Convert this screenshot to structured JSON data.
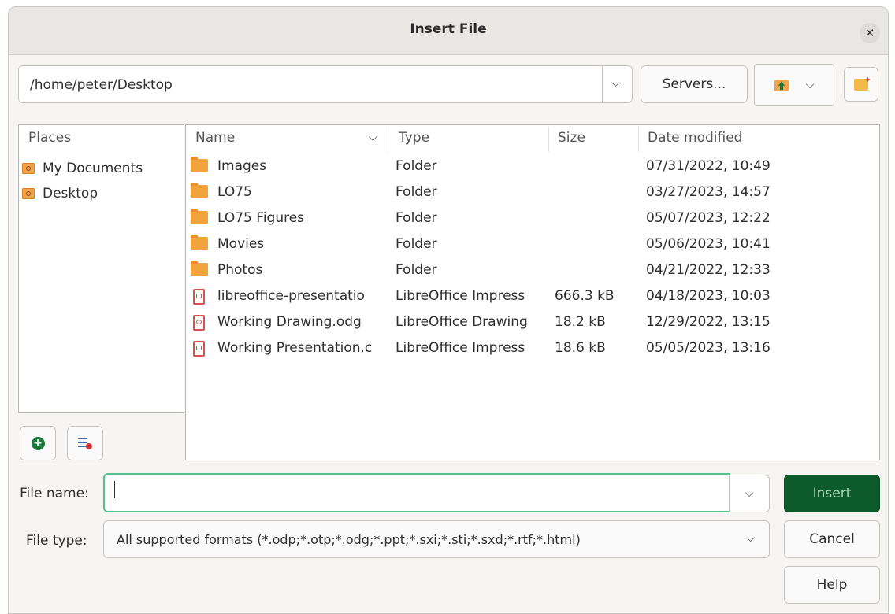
{
  "window": {
    "title": "Insert File",
    "close_icon": "close-icon"
  },
  "toolbar": {
    "path": "/home/peter/Desktop",
    "servers_label": "Servers...",
    "up_icon": "folder-up-icon",
    "new_folder_icon": "new-folder-icon"
  },
  "places": {
    "header": "Places",
    "items": [
      {
        "label": "My Documents",
        "icon": "folder-icon"
      },
      {
        "label": "Desktop",
        "icon": "folder-icon"
      }
    ],
    "add_icon": "add-place-icon",
    "remove_icon": "remove-place-icon"
  },
  "files": {
    "columns": {
      "name": "Name",
      "type": "Type",
      "size": "Size",
      "date": "Date modified"
    },
    "sort_icon": "chevron-down-icon",
    "rows": [
      {
        "name": "Images",
        "type": "Folder",
        "size": "",
        "date": "07/31/2022, 10:49",
        "icon": "folder-icon"
      },
      {
        "name": "LO75",
        "type": "Folder",
        "size": "",
        "date": "03/27/2023, 14:57",
        "icon": "folder-icon"
      },
      {
        "name": "LO75 Figures",
        "type": "Folder",
        "size": "",
        "date": "05/07/2023, 12:22",
        "icon": "folder-icon"
      },
      {
        "name": "Movies",
        "type": "Folder",
        "size": "",
        "date": "05/06/2023, 10:41",
        "icon": "folder-icon"
      },
      {
        "name": "Photos",
        "type": "Folder",
        "size": "",
        "date": "04/21/2022, 12:33",
        "icon": "folder-icon"
      },
      {
        "name": "libreoffice-presentatio",
        "type": "LibreOffice Impress",
        "size": "666.3 kB",
        "date": "04/18/2023, 10:03",
        "icon": "impress-doc-icon"
      },
      {
        "name": "Working Drawing.odg",
        "type": "LibreOffice Drawing",
        "size": "18.2 kB",
        "date": "12/29/2022, 13:15",
        "icon": "draw-doc-icon"
      },
      {
        "name": "Working Presentation.c",
        "type": "LibreOffice Impress",
        "size": "18.6 kB",
        "date": "05/05/2023, 13:16",
        "icon": "impress-doc-icon"
      }
    ]
  },
  "form": {
    "file_name_label": "File name:",
    "file_name_value": "",
    "file_type_label": "File type:",
    "file_type_value": "All supported formats (*.odp;*.otp;*.odg;*.ppt;*.sxi;*.sti;*.sxd;*.rtf;*.html)"
  },
  "buttons": {
    "insert": "Insert",
    "cancel": "Cancel",
    "help": "Help"
  },
  "colors": {
    "accent": "#0d5a2a",
    "focus": "#55c089",
    "folder": "#f3a33c",
    "doc": "#d6524f"
  }
}
